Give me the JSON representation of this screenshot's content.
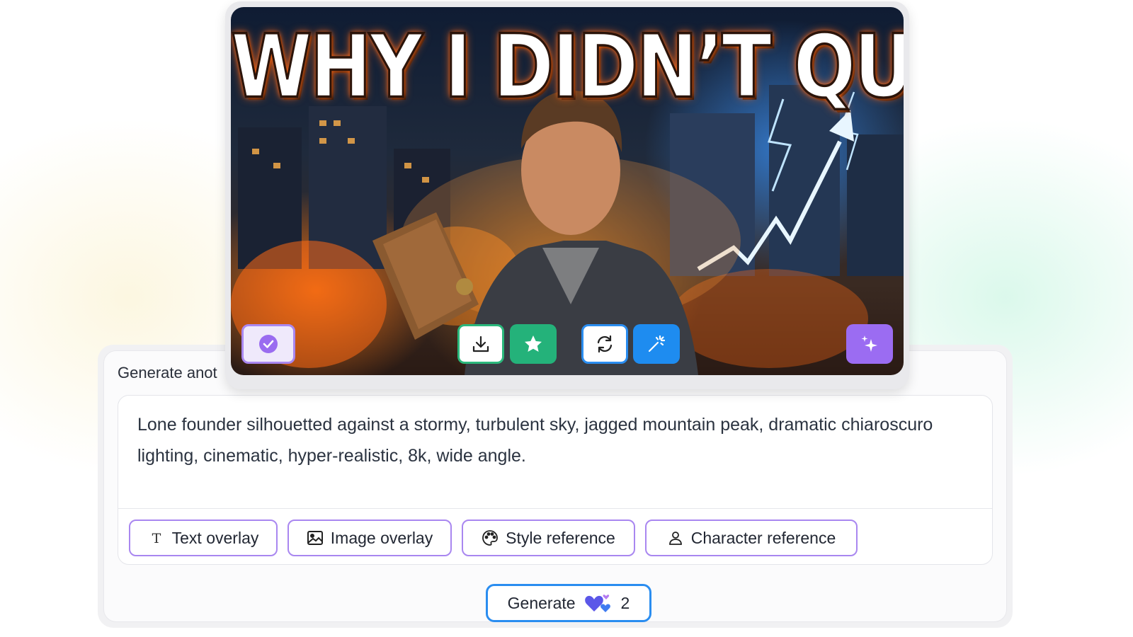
{
  "thumbnail": {
    "headline": "WHY I DIDN’T QUIT"
  },
  "thumbnail_actions": [
    {
      "name": "select",
      "icon": "check-circle-icon"
    },
    {
      "name": "download",
      "icon": "download-icon"
    },
    {
      "name": "favorite",
      "icon": "star-icon"
    },
    {
      "name": "regenerate",
      "icon": "refresh-icon"
    },
    {
      "name": "enhance",
      "icon": "magic-wand-icon"
    },
    {
      "name": "variations",
      "icon": "sparkles-icon"
    }
  ],
  "panel": {
    "title": "Generate anot",
    "prompt": "Lone founder silhouetted against a stormy, turbulent sky, jagged mountain peak, dramatic chiaroscuro lighting, cinematic, hyper-realistic, 8k, wide angle.",
    "chips": {
      "text_overlay": "Text overlay",
      "image_overlay": "Image overlay",
      "style_reference": "Style reference",
      "character_reference": "Character reference"
    },
    "generate": {
      "label": "Generate",
      "cost": "2"
    }
  },
  "colors": {
    "accent_purple": "#a987f0",
    "accent_blue": "#2a8df0",
    "accent_green": "#24b27a"
  }
}
